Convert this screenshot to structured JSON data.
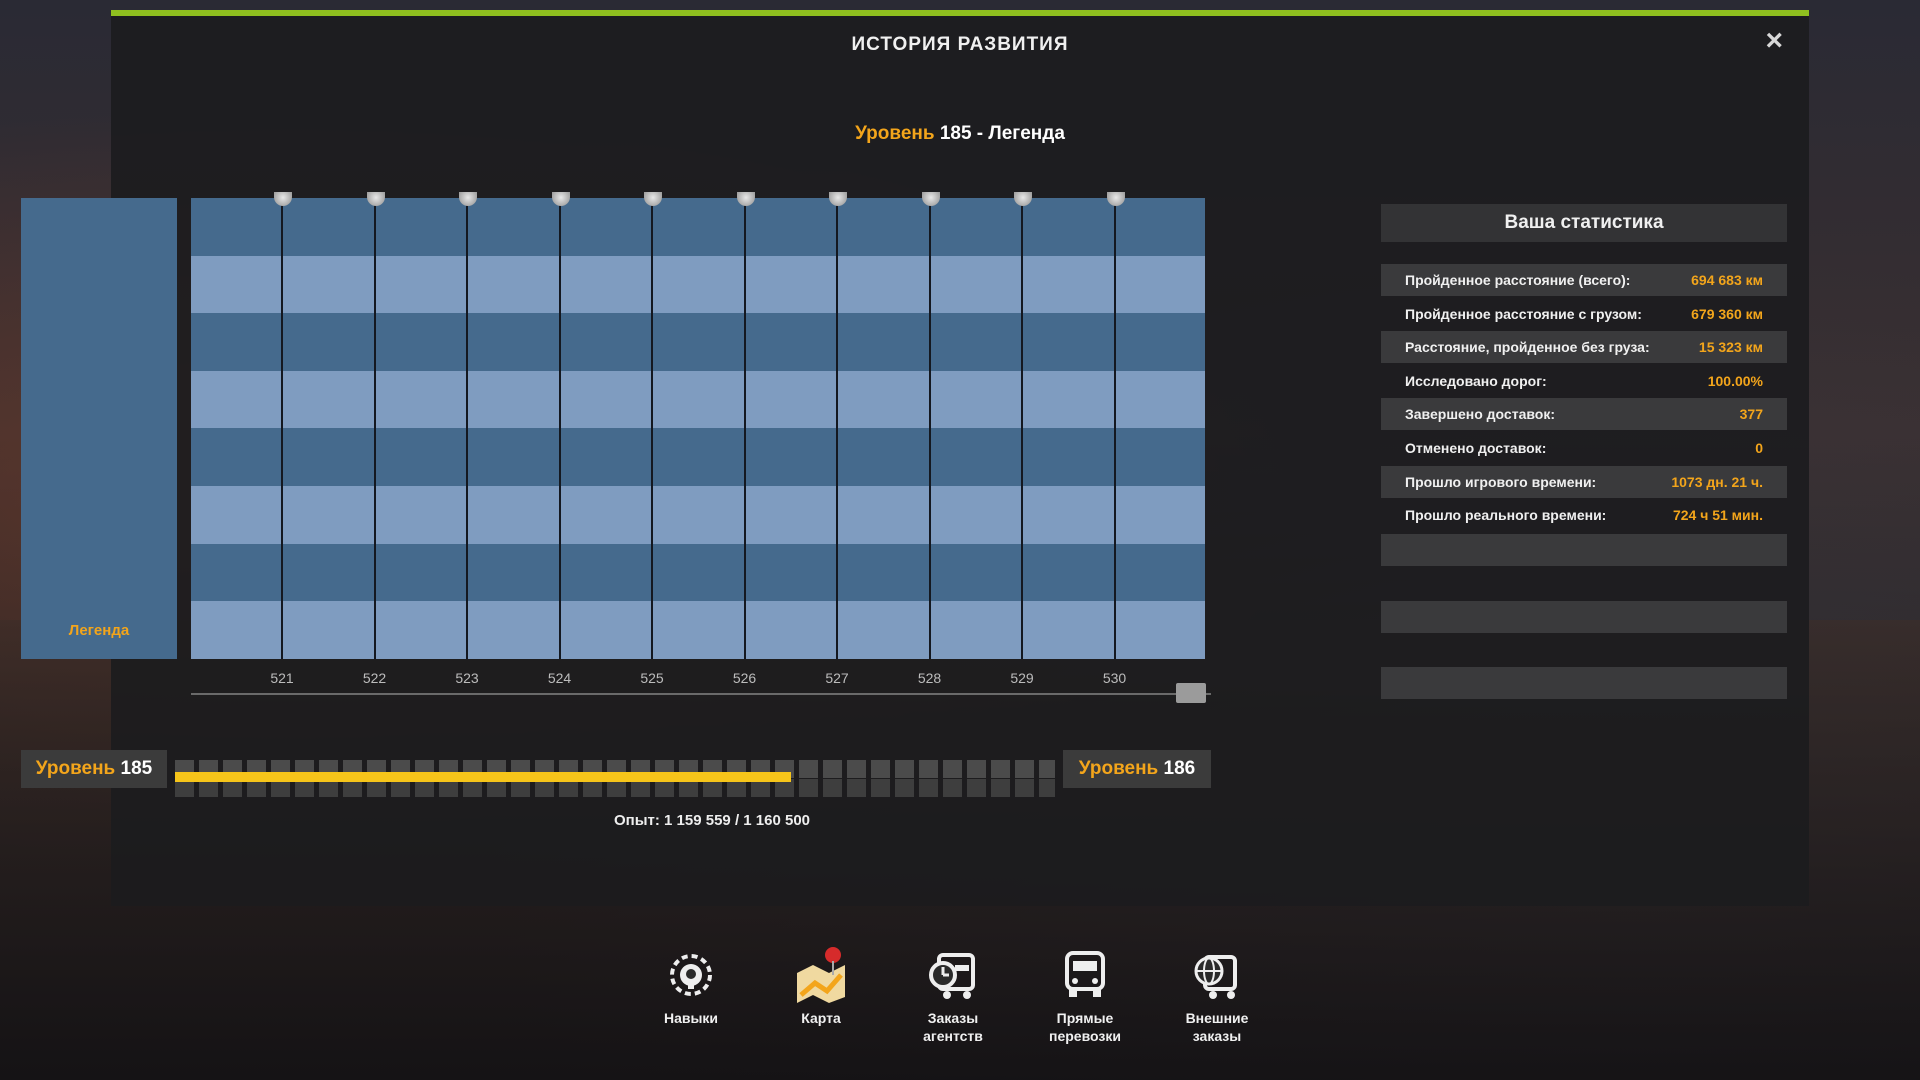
{
  "window": {
    "title": "ИСТОРИЯ РАЗВИТИЯ",
    "close_icon": "×"
  },
  "header": {
    "level_word": "Уровень",
    "level_rest": " 185 - Легенда"
  },
  "legend": {
    "label": "Легенда"
  },
  "timeline": {
    "ticks": [
      "521",
      "522",
      "523",
      "524",
      "525",
      "526",
      "527",
      "528",
      "529",
      "530"
    ]
  },
  "progress": {
    "current_word": "Уровень",
    "current_num": " 185",
    "next_word": "Уровень",
    "next_num": " 186",
    "fraction": 0.7,
    "xp_text": "Опыт: 1 159 559 / 1 160 500"
  },
  "stats": {
    "header": "Ваша статистика",
    "rows": [
      {
        "label": "Пройденное расстояние (всего):",
        "value": "694 683 км"
      },
      {
        "label": "Пройденное расстояние с грузом:",
        "value": "679 360 км"
      },
      {
        "label": "Расстояние, пройденное без груза:",
        "value": "15 323 км"
      },
      {
        "label": "Исследовано дорог:",
        "value": "100.00%"
      },
      {
        "label": "Завершено доставок:",
        "value": "377"
      },
      {
        "label": "Отменено доставок:",
        "value": "0"
      },
      {
        "label": "Прошло игрового времени:",
        "value": "1073 дн. 21 ч."
      },
      {
        "label": "Прошло реального времени:",
        "value": "724 ч 51 мин."
      }
    ]
  },
  "nav": [
    {
      "l1": "Навыки",
      "l2": "",
      "icon": "skills-icon"
    },
    {
      "l1": "Карта",
      "l2": "",
      "icon": "map-icon"
    },
    {
      "l1": "Заказы",
      "l2": "агентств",
      "icon": "agency-orders-icon"
    },
    {
      "l1": "Прямые",
      "l2": "перевозки",
      "icon": "direct-transport-icon"
    },
    {
      "l1": "Внешние",
      "l2": "заказы",
      "icon": "external-orders-icon"
    }
  ],
  "colors": {
    "accent": "#8fbf1f",
    "orange": "#f3a51b",
    "xp_fill": "#f6c51a",
    "band_dark": "#456a8d",
    "band_light": "#7f9cc0"
  }
}
